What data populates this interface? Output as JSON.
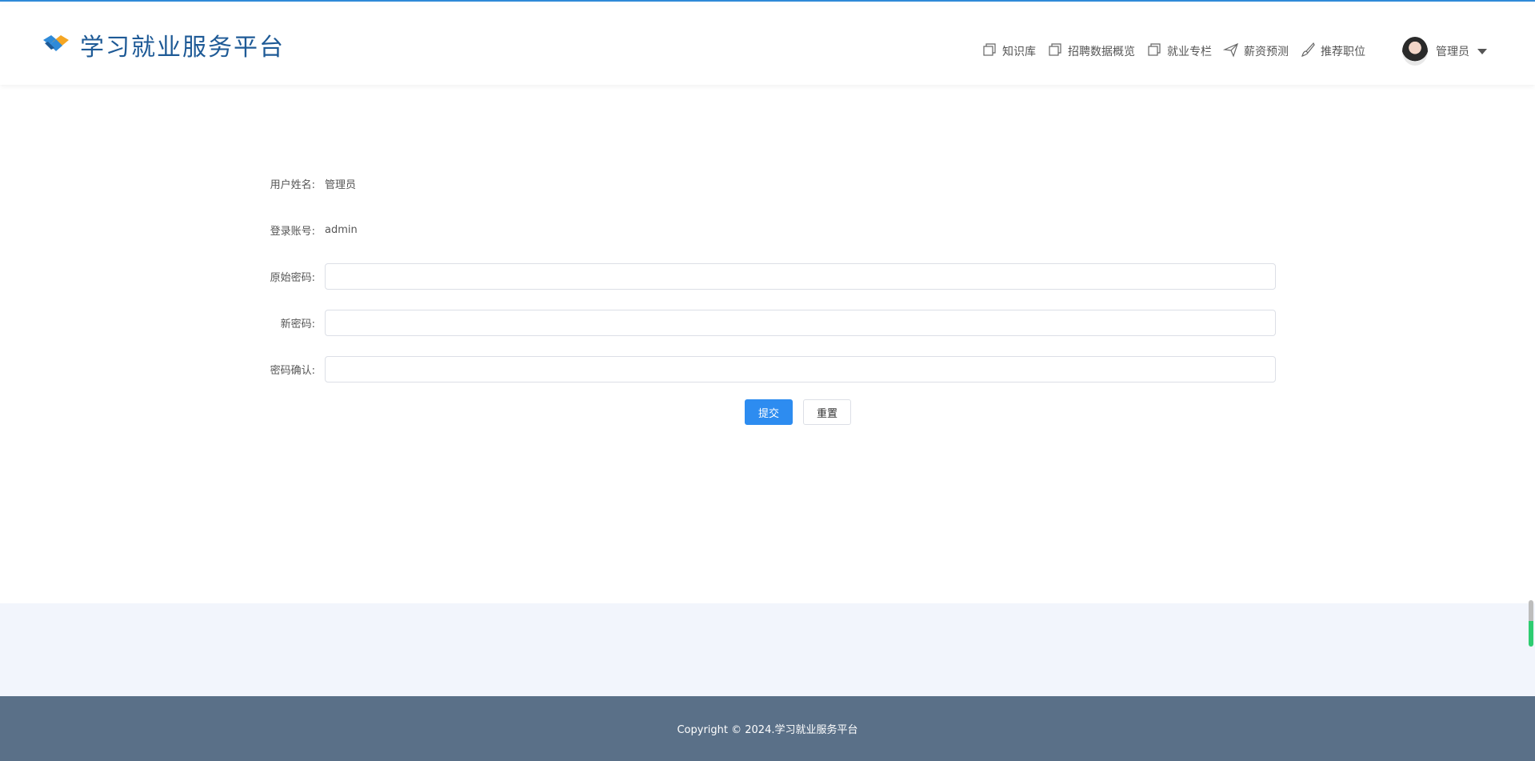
{
  "brand": {
    "title": "学习就业服务平台",
    "logo_icon": "handshake-icon",
    "colors": {
      "primary": "#1e5a96",
      "accent": "#f5a623",
      "blue": "#2f8ad8"
    }
  },
  "nav": {
    "items": [
      {
        "label": "知识库",
        "icon": "copy-icon"
      },
      {
        "label": "招聘数据概览",
        "icon": "copy-icon"
      },
      {
        "label": "就业专栏",
        "icon": "copy-icon"
      },
      {
        "label": "薪资预测",
        "icon": "send-icon"
      },
      {
        "label": "推荐职位",
        "icon": "brush-icon"
      }
    ]
  },
  "user": {
    "name": "管理员",
    "avatar_icon": "avatar-icon",
    "dropdown_icon": "caret-down-icon"
  },
  "form": {
    "username_label": "用户姓名:",
    "username_value": "管理员",
    "account_label": "登录账号:",
    "account_value": "admin",
    "old_password_label": "原始密码:",
    "old_password_value": "",
    "new_password_label": "新密码:",
    "new_password_value": "",
    "confirm_password_label": "密码确认:",
    "confirm_password_value": ""
  },
  "actions": {
    "submit_label": "提交",
    "reset_label": "重置",
    "primary_color": "#2d8cf0"
  },
  "footer": {
    "copyright": "Copyright © 2024.学习就业服务平台",
    "background": "#5a7088"
  }
}
